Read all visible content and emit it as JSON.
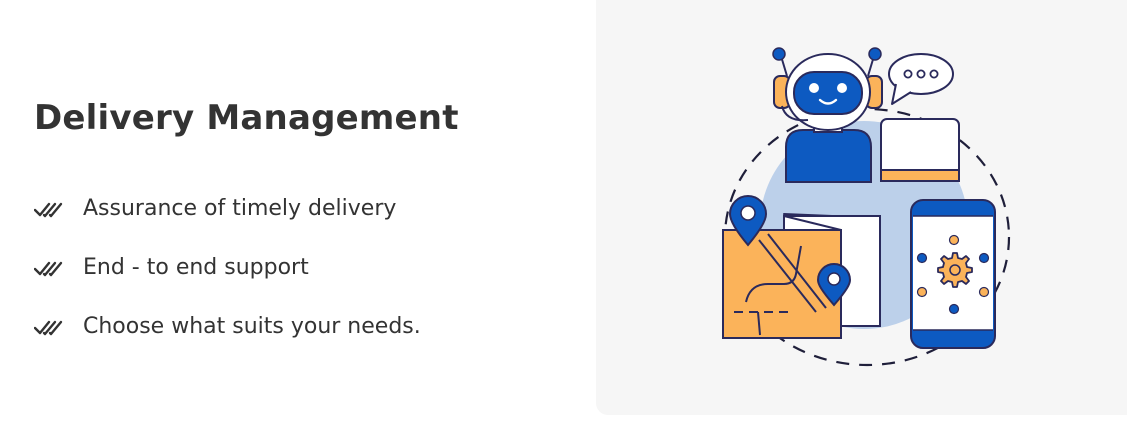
{
  "section": {
    "title": "Delivery Management"
  },
  "features": [
    {
      "label": "Assurance of timely delivery",
      "icon": "double-check-icon"
    },
    {
      "label": "End - to end support",
      "icon": "double-check-icon"
    },
    {
      "label": "Choose what suits your needs.",
      "icon": "double-check-icon"
    }
  ],
  "illustration": {
    "name": "delivery-support-illustration",
    "icons": [
      "robot-assistant-icon",
      "chat-bubble-icon",
      "laptop-icon",
      "map-icon",
      "location-pin-icon",
      "smartphone-icon",
      "gear-icon"
    ]
  },
  "colors": {
    "text": "#333333",
    "primary_blue": "#0d5ac1",
    "accent_orange": "#fbb35a",
    "outline_navy": "#2a2a5c",
    "circle_light_blue": "#bcd0ea",
    "panel_bg": "#f6f6f6"
  }
}
